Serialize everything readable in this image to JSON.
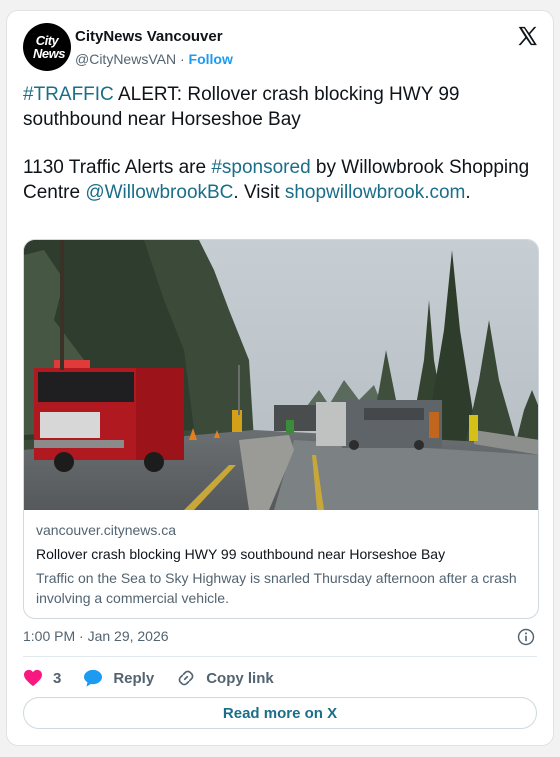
{
  "author": {
    "avatar_line1": "City",
    "avatar_line2": "News",
    "name": "CityNews Vancouver",
    "handle": "@CityNewsVAN",
    "separator": "·",
    "follow": "Follow"
  },
  "tweet": {
    "p1": {
      "hashtag": "#TRAFFIC",
      "text": " ALERT: Rollover crash blocking HWY 99 southbound near Horseshoe Bay"
    },
    "p2": {
      "t1": "1130 Traffic Alerts are ",
      "hashtag": "#sponsored",
      "t2": " by Willowbrook Shopping Centre ",
      "mention": "@WillowbrookBC",
      "t3": ". Visit ",
      "url": "shopwillowbrook.com",
      "t4": "."
    }
  },
  "card": {
    "domain": "vancouver.citynews.ca",
    "headline": "Rollover crash blocking HWY 99 southbound near Horseshoe Bay",
    "description": "Traffic on the Sea to Sky Highway is snarled Thursday afternoon after a crash involving a commercial vehicle."
  },
  "timestamp": "1:00 PM · Jan 29, 2026",
  "actions": {
    "like_count": "3",
    "reply": "Reply",
    "copy_link": "Copy link"
  },
  "read_more": "Read more on X",
  "colors": {
    "link": "#1a6e8a",
    "heart": "#f91880",
    "reply": "#1d9bf0",
    "muted": "#536471"
  },
  "icons": [
    "x-logo-icon",
    "info-icon",
    "heart-icon",
    "reply-icon",
    "link-icon"
  ]
}
